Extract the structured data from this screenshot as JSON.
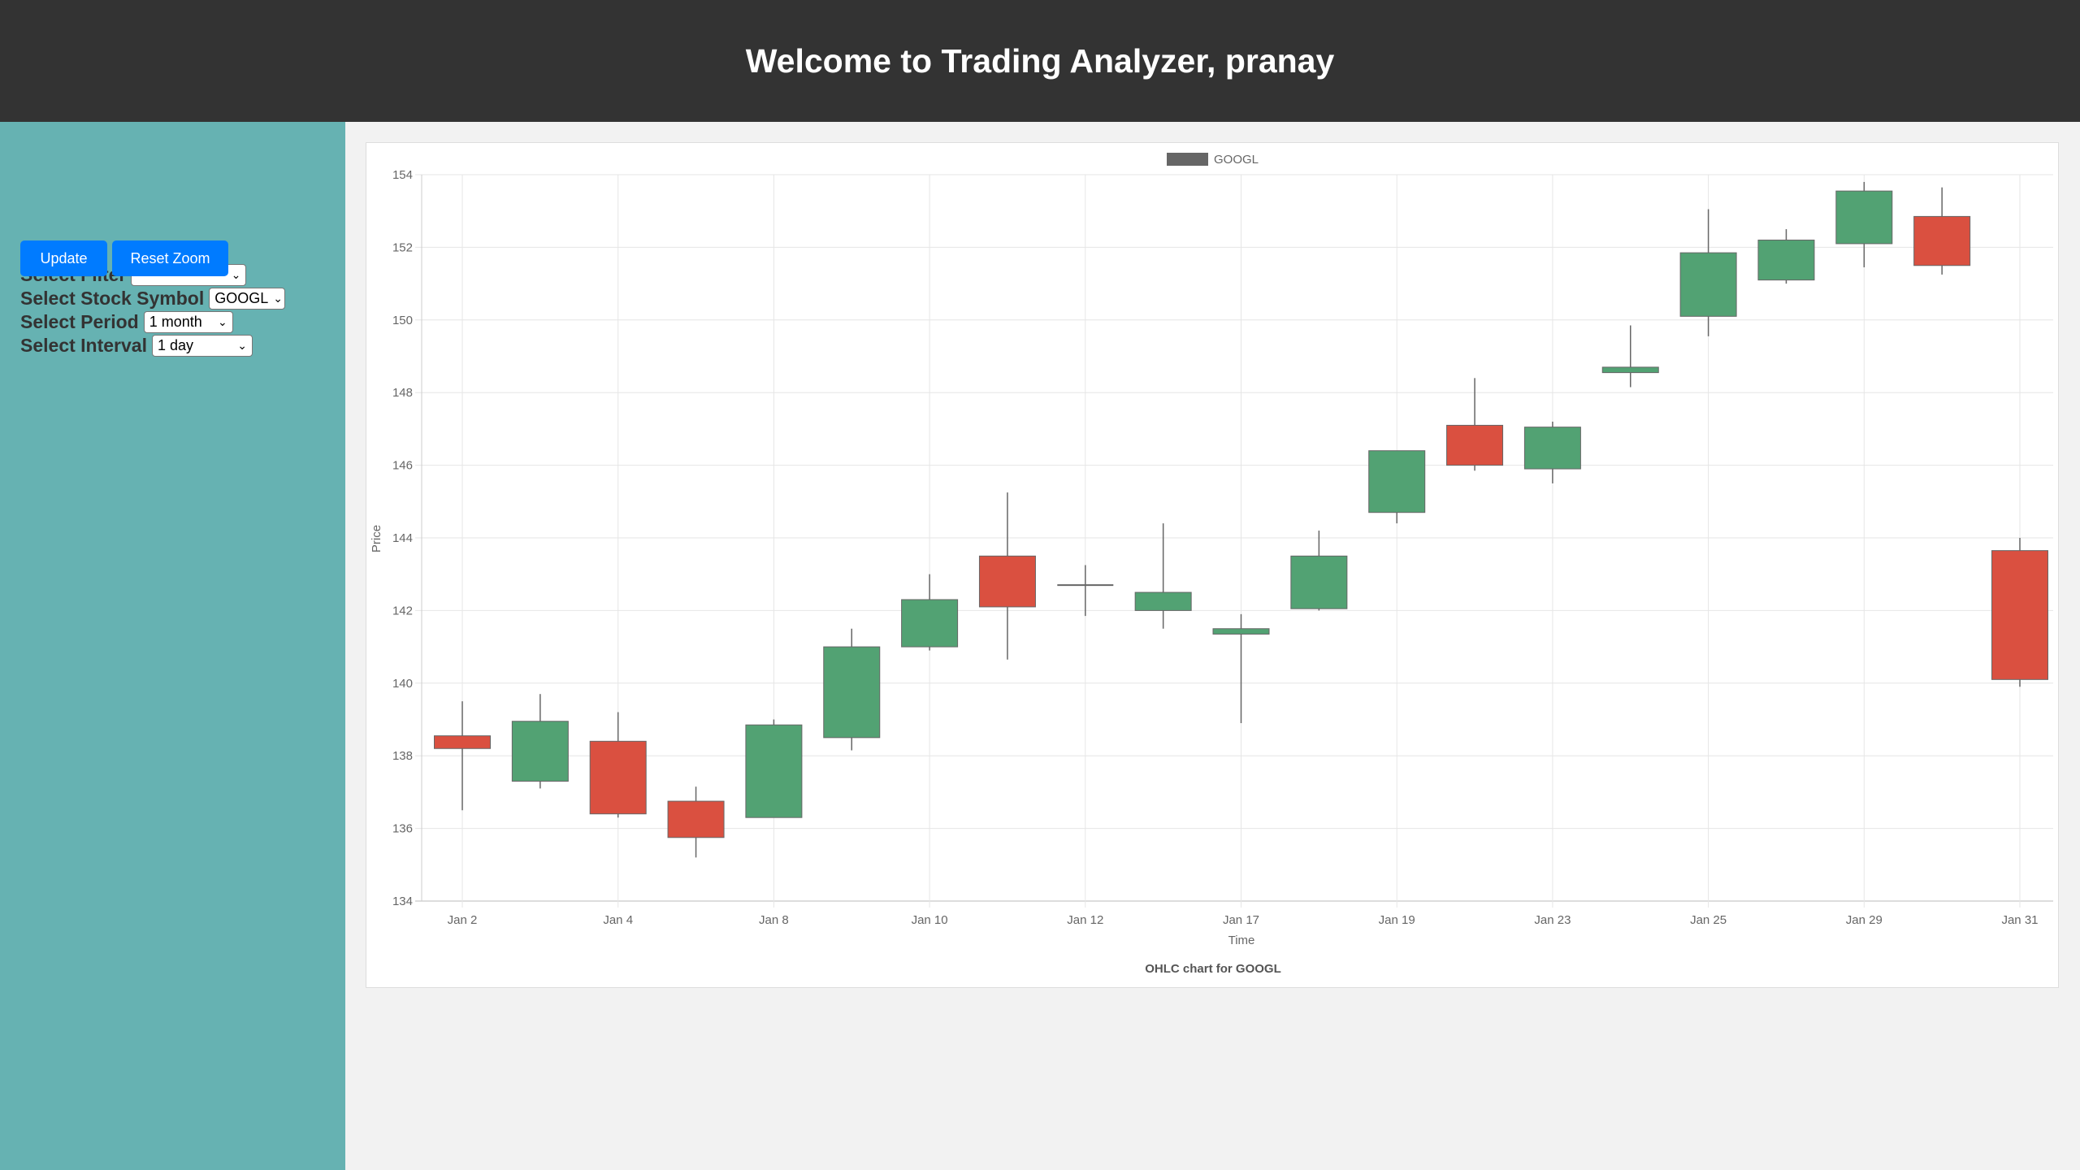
{
  "header": {
    "title": "Welcome to Trading Analyzer, pranay"
  },
  "sidebar": {
    "filter": {
      "label": "Select Filter",
      "value": ""
    },
    "symbol": {
      "label": "Select Stock Symbol",
      "value": "GOOGL"
    },
    "period": {
      "label": "Select Period",
      "value": "1 month"
    },
    "interval": {
      "label": "Select Interval",
      "value": "1 day"
    },
    "update_label": "Update",
    "reset_label": "Reset Zoom"
  },
  "colors": {
    "up": "#52a273",
    "down": "#da5040",
    "header_bg": "#333333",
    "sidebar_bg": "#66b2b2",
    "button": "#007bff"
  },
  "chart_data": {
    "type": "ohlc-candlestick",
    "title": "OHLC chart for GOOGL",
    "legend": [
      "GOOGL"
    ],
    "legend_position": "top",
    "xlabel": "Time",
    "ylabel": "Price",
    "ylim": [
      134,
      154
    ],
    "yticks": [
      134,
      136,
      138,
      140,
      142,
      144,
      146,
      148,
      150,
      152,
      154
    ],
    "xtick_labels": [
      "Jan 2",
      "Jan 4",
      "Jan 8",
      "Jan 10",
      "Jan 12",
      "Jan 17",
      "Jan 19",
      "Jan 23",
      "Jan 25",
      "Jan 29",
      "Jan 31"
    ],
    "grid": true,
    "candles": [
      {
        "o": 138.55,
        "h": 139.5,
        "l": 136.5,
        "c": 138.2
      },
      {
        "o": 137.3,
        "h": 139.7,
        "l": 137.1,
        "c": 138.95
      },
      {
        "o": 138.4,
        "h": 139.2,
        "l": 136.3,
        "c": 136.4
      },
      {
        "o": 136.75,
        "h": 137.15,
        "l": 135.2,
        "c": 135.75
      },
      {
        "o": 136.3,
        "h": 139.0,
        "l": 136.3,
        "c": 138.85
      },
      {
        "o": 138.5,
        "h": 141.5,
        "l": 138.15,
        "c": 141.0
      },
      {
        "o": 141.0,
        "h": 143.0,
        "l": 140.9,
        "c": 142.3
      },
      {
        "o": 143.5,
        "h": 145.25,
        "l": 140.65,
        "c": 142.1
      },
      {
        "o": 142.7,
        "h": 143.25,
        "l": 141.85,
        "c": 142.7
      },
      {
        "o": 142.0,
        "h": 144.4,
        "l": 141.5,
        "c": 142.5
      },
      {
        "o": 141.35,
        "h": 141.9,
        "l": 138.9,
        "c": 141.5
      },
      {
        "o": 142.05,
        "h": 144.2,
        "l": 142.0,
        "c": 143.5
      },
      {
        "o": 144.7,
        "h": 146.4,
        "l": 144.4,
        "c": 146.4
      },
      {
        "o": 147.1,
        "h": 148.4,
        "l": 145.85,
        "c": 146.0
      },
      {
        "o": 145.9,
        "h": 147.2,
        "l": 145.5,
        "c": 147.05
      },
      {
        "o": 148.55,
        "h": 149.85,
        "l": 148.15,
        "c": 148.7
      },
      {
        "o": 150.1,
        "h": 153.05,
        "l": 149.55,
        "c": 151.85
      },
      {
        "o": 151.1,
        "h": 152.5,
        "l": 151.0,
        "c": 152.2
      },
      {
        "o": 152.1,
        "h": 153.8,
        "l": 151.45,
        "c": 153.55
      },
      {
        "o": 152.85,
        "h": 153.65,
        "l": 151.25,
        "c": 151.5
      },
      {
        "o": 143.65,
        "h": 144.0,
        "l": 139.9,
        "c": 140.1
      }
    ]
  }
}
